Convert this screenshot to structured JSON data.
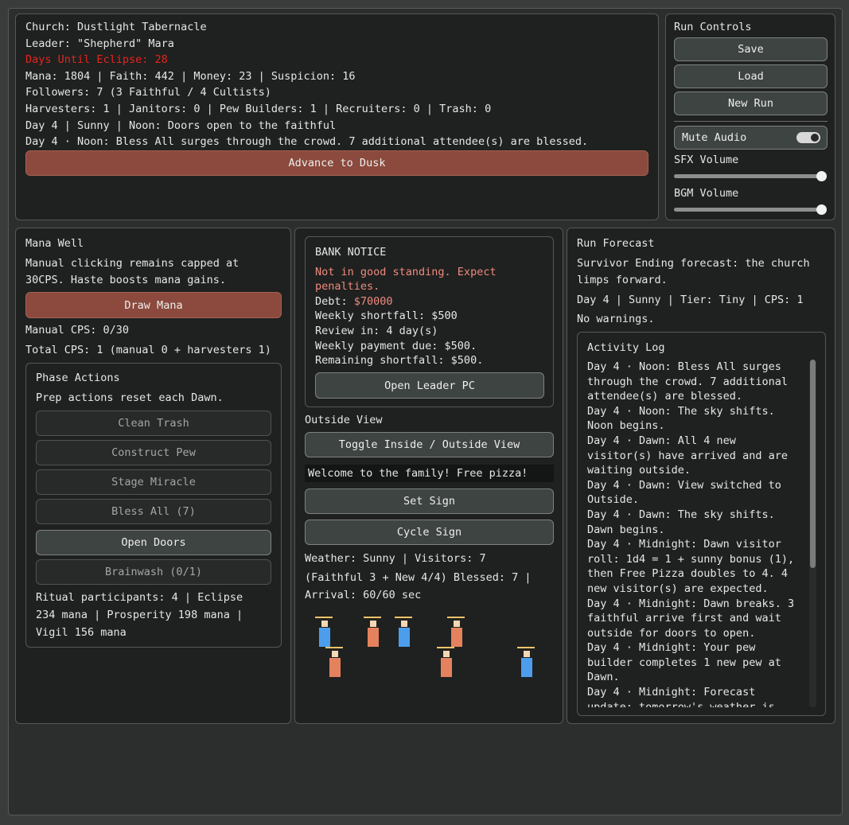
{
  "status": {
    "church": "Church: Dustlight Tabernacle",
    "leader": "Leader: \"Shepherd\" Mara",
    "eclipse": "Days Until Eclipse: 28",
    "resources": "Mana: 1804 | Faith: 442 | Money: 23 | Suspicion: 16",
    "followers": "Followers: 7 (3 Faithful / 4 Cultists)",
    "staff": "Harvesters: 1 | Janitors: 0 | Pew Builders: 1 | Recruiters: 0 | Trash: 0",
    "time": "Day 4 | Sunny | Noon: Doors open to the faithful",
    "event": "Day 4 · Noon: Bless All surges through the crowd. 7 additional attendee(s) are blessed.",
    "advance_label": "Advance to Dusk"
  },
  "run_controls": {
    "title": "Run Controls",
    "save": "Save",
    "load": "Load",
    "new_run": "New Run",
    "mute": "Mute Audio",
    "mute_on": true,
    "sfx_label": "SFX Volume",
    "sfx_value": 1.0,
    "bgm_label": "BGM Volume",
    "bgm_value": 1.0
  },
  "mana_well": {
    "title": "Mana Well",
    "desc1": "Manual clicking remains capped at",
    "desc2": "30CPS. Haste boosts mana gains.",
    "draw_label": "Draw Mana",
    "manual_cps": "Manual CPS: 0/30",
    "total_cps": "Total CPS: 1 (manual 0 + harvesters 1)"
  },
  "phase_actions": {
    "title": "Phase Actions",
    "desc": "Prep actions reset each Dawn.",
    "buttons": [
      "Clean Trash",
      "Construct Pew",
      "Stage Miracle",
      "Bless All (7)",
      "Open Doors",
      "Brainwash (0/1)"
    ],
    "ritual1": "Ritual participants: 4 | Eclipse",
    "ritual2": "234 mana | Prosperity 198 mana |",
    "ritual3": "Vigil 156 mana"
  },
  "bank": {
    "title": "BANK NOTICE",
    "warning1": "Not in good standing. Expect",
    "warning2": "penalties.",
    "debt_label": "Debt: ",
    "debt_value": "$70000",
    "shortfall": "Weekly shortfall: $500",
    "review": "Review in: 4 day(s)",
    "payment": "Weekly payment due: $500.",
    "remaining": "Remaining shortfall: $500.",
    "open_pc": "Open Leader PC"
  },
  "outside": {
    "title": "Outside View",
    "toggle": "Toggle Inside / Outside View",
    "sign_text": "Welcome to the family! Free pizza!",
    "set_sign": "Set Sign",
    "cycle_sign": "Cycle Sign",
    "info1": "Weather: Sunny | Visitors: 7",
    "info2": "(Faithful 3 + New 4/4) Blessed: 7 |",
    "info3": "Arrival: 60/60 sec",
    "faithful_color": "#4d9ded",
    "new_color": "#e5825e"
  },
  "forecast": {
    "title": "Run Forecast",
    "line1": "Survivor Ending forecast: the church",
    "line2": "limps forward.",
    "summary": "Day 4 | Sunny | Tier: Tiny | CPS: 1",
    "warnings": "No warnings."
  },
  "activity_log": {
    "title": "Activity Log",
    "text": "Day 4 · Noon: Bless All surges\nthrough the crowd. 7 additional\nattendee(s) are blessed.\nDay 4 · Noon: The sky shifts.\nNoon begins.\nDay 4 · Dawn: All 4 new\nvisitor(s) have arrived and are\nwaiting outside.\nDay 4 · Dawn: View switched to\nOutside.\nDay 4 · Dawn: The sky shifts.\nDawn begins.\nDay 4 · Midnight: Dawn visitor\nroll: 1d4 = 1 + sunny bonus (1),\nthen Free Pizza doubles to 4. 4\nnew visitor(s) are expected.\nDay 4 · Midnight: Dawn breaks. 3\nfaithful arrive first and wait\noutside for doors to open.\nDay 4 · Midnight: Your pew\nbuilder completes 1 new pew at\nDawn.\nDay 4 · Midnight: Forecast\nupdate: tomorrow's weather is"
  }
}
